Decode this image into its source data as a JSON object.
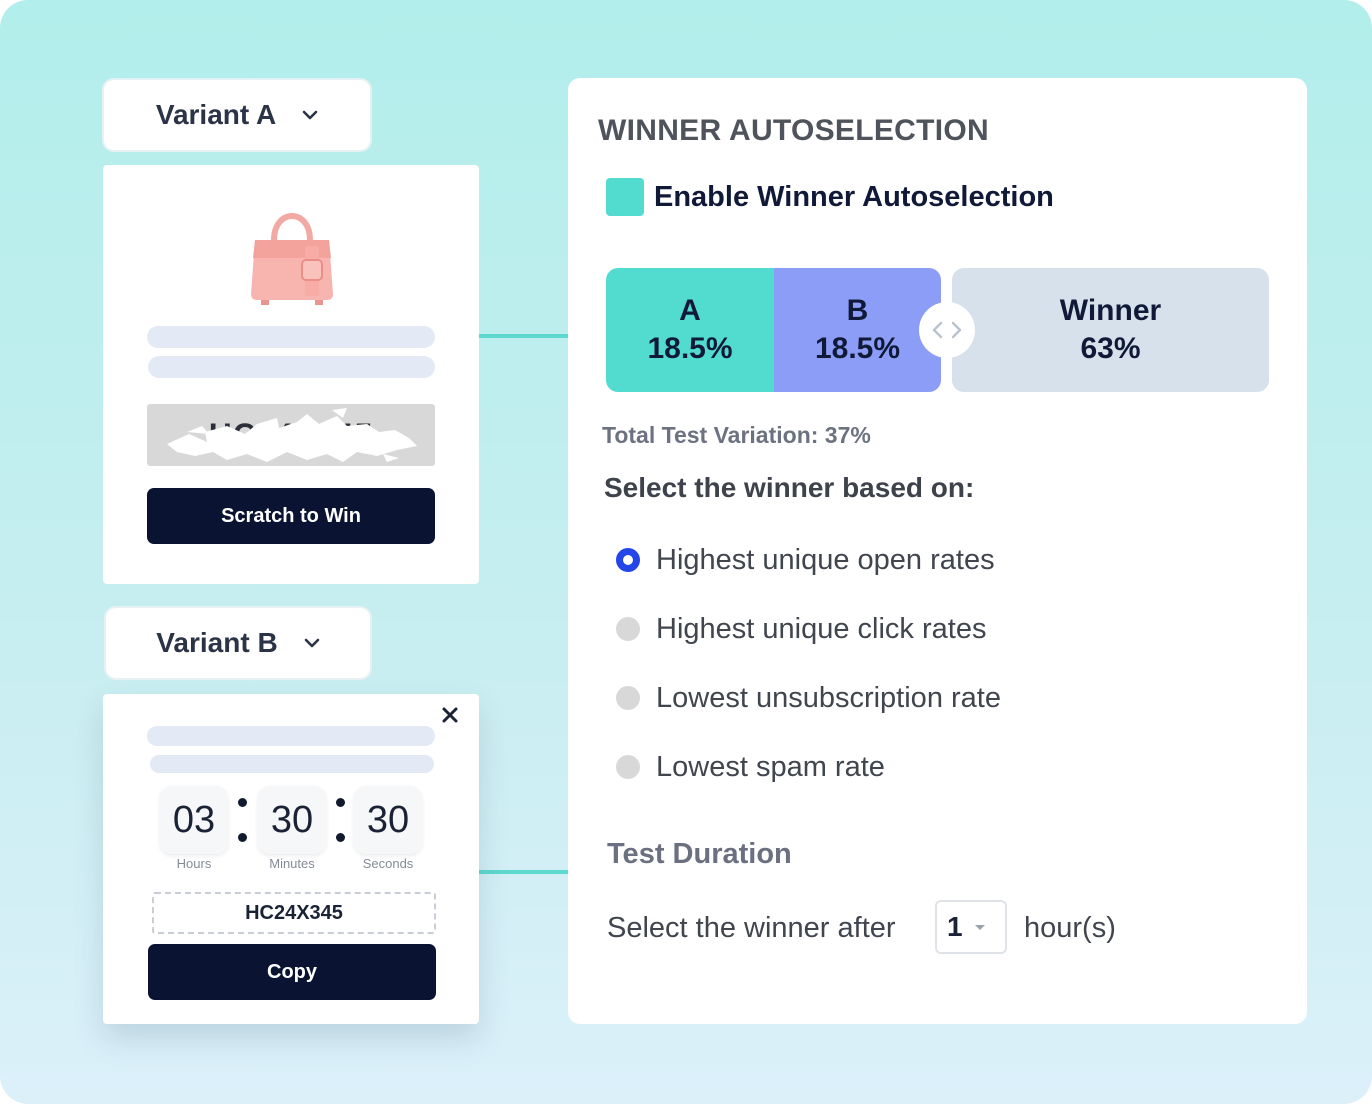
{
  "variant_a": {
    "dropdown_label": "Variant A",
    "coupon_code": "HC24X345",
    "button_label": "Scratch to Win"
  },
  "variant_b": {
    "dropdown_label": "Variant B",
    "timer": {
      "hours": "03",
      "minutes": "30",
      "seconds": "30",
      "hours_label": "Hours",
      "minutes_label": "Minutes",
      "seconds_label": "Seconds"
    },
    "coupon_code": "HC24X345",
    "button_label": "Copy"
  },
  "panel": {
    "title": "WINNER AUTOSELECTION",
    "enable_label": "Enable Winner Autoselection",
    "enable_checked": true,
    "split": {
      "a_label": "A",
      "a_value": "18.5%",
      "b_label": "B",
      "b_value": "18.5%",
      "winner_label": "Winner",
      "winner_value": "63%"
    },
    "total_label": "Total Test Variation: 37%",
    "criteria_heading": "Select the winner based on:",
    "criteria_options": [
      {
        "label": "Highest unique open rates",
        "selected": true
      },
      {
        "label": "Highest unique click rates",
        "selected": false
      },
      {
        "label": "Lowest unsubscription rate",
        "selected": false
      },
      {
        "label": "Lowest spam rate",
        "selected": false
      }
    ],
    "duration_heading": "Test Duration",
    "duration_prefix": "Select the winner after",
    "duration_value": "1",
    "duration_suffix": "hour(s)"
  },
  "colors": {
    "teal": "#52dcd0",
    "violet": "#8c9df8",
    "winner_grey": "#d7e1eb",
    "navy": "#0a1331",
    "radio_blue": "#2445e8"
  }
}
